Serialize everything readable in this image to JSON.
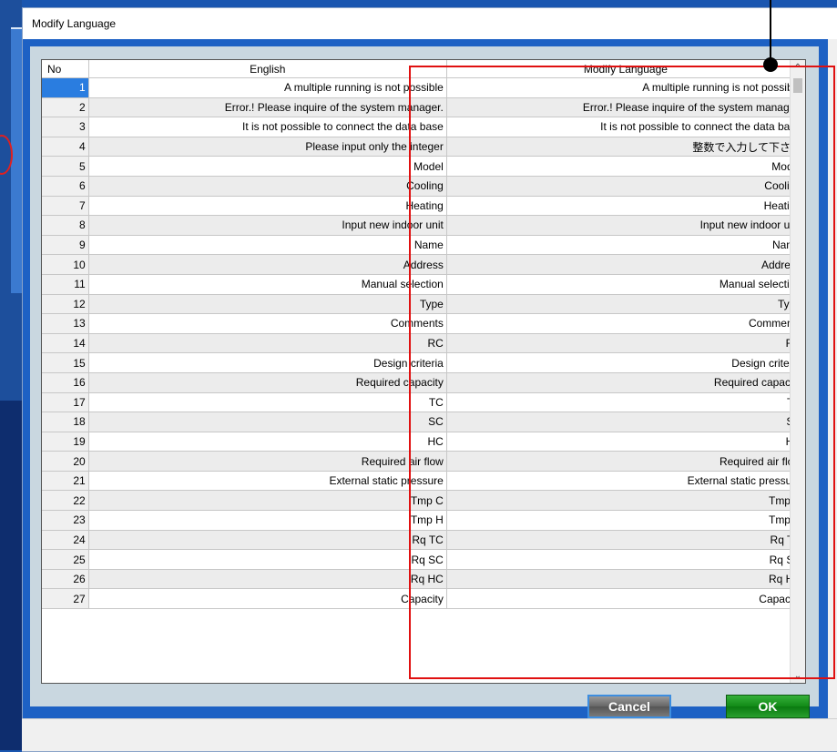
{
  "window": {
    "title": "Modify Language"
  },
  "table": {
    "headers": {
      "no": "No",
      "english": "English",
      "modify": "Modify Language"
    },
    "rows": [
      {
        "no": "1",
        "en": "A multiple running is not possible",
        "mod": "A multiple running is not possible"
      },
      {
        "no": "2",
        "en": "Error.! Please inquire of the system manager.",
        "mod": "Error.! Please inquire of the system manager."
      },
      {
        "no": "3",
        "en": "It is not possible to connect the data base",
        "mod": "It is not possible to connect the data base"
      },
      {
        "no": "4",
        "en": "Please input only the integer",
        "mod": "整数で入力して下さい"
      },
      {
        "no": "5",
        "en": "Model",
        "mod": "Model"
      },
      {
        "no": "6",
        "en": "Cooling",
        "mod": "Cooling"
      },
      {
        "no": "7",
        "en": "Heating",
        "mod": "Heating"
      },
      {
        "no": "8",
        "en": "Input new indoor unit",
        "mod": "Input new indoor unit"
      },
      {
        "no": "9",
        "en": "Name",
        "mod": "Name"
      },
      {
        "no": "10",
        "en": "Address",
        "mod": "Address"
      },
      {
        "no": "11",
        "en": "Manual selection",
        "mod": "Manual selection"
      },
      {
        "no": "12",
        "en": "Type",
        "mod": "Type"
      },
      {
        "no": "13",
        "en": "Comments",
        "mod": "Comments"
      },
      {
        "no": "14",
        "en": "RC",
        "mod": "RC"
      },
      {
        "no": "15",
        "en": "Design criteria",
        "mod": "Design criteria"
      },
      {
        "no": "16",
        "en": "Required capacity",
        "mod": "Required capacity"
      },
      {
        "no": "17",
        "en": "TC",
        "mod": "TC"
      },
      {
        "no": "18",
        "en": "SC",
        "mod": "SC"
      },
      {
        "no": "19",
        "en": "HC",
        "mod": "HC"
      },
      {
        "no": "20",
        "en": "Required air flow",
        "mod": "Required air flow"
      },
      {
        "no": "21",
        "en": "External static pressure",
        "mod": "External static pressure"
      },
      {
        "no": "22",
        "en": "Tmp C",
        "mod": "Tmp C"
      },
      {
        "no": "23",
        "en": "Tmp H",
        "mod": "Tmp H"
      },
      {
        "no": "24",
        "en": "Rq TC",
        "mod": "Rq TC"
      },
      {
        "no": "25",
        "en": "Rq SC",
        "mod": "Rq SC"
      },
      {
        "no": "26",
        "en": "Rq HC",
        "mod": "Rq HC"
      },
      {
        "no": "27",
        "en": "Capacity",
        "mod": "Capacity"
      }
    ]
  },
  "buttons": {
    "cancel": "Cancel",
    "ok": "OK"
  },
  "colors": {
    "highlight": "#e01010",
    "selected_row": "#2a7de0",
    "ok_button": "#118a16",
    "cancel_button": "#666666"
  },
  "icons": {
    "scroll_up": "chevron-up-icon",
    "scroll_down": "chevron-down-icon"
  }
}
